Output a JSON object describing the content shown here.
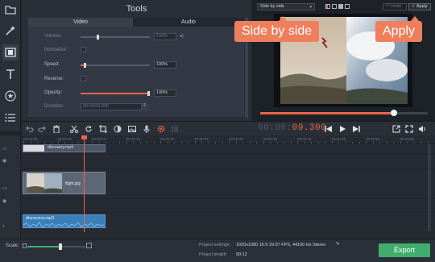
{
  "tools": {
    "title": "Tools",
    "tabs": [
      {
        "label": "Video"
      },
      {
        "label": "Audio"
      }
    ],
    "rows": {
      "volume": {
        "label": "Volume:",
        "value": "100%",
        "enabled": false,
        "level": 0.4
      },
      "normalize": {
        "label": "Normalize:",
        "enabled": false
      },
      "speed": {
        "label": "Speed:",
        "value": "100%",
        "enabled": true,
        "level": 0.05
      },
      "reverse": {
        "label": "Reverse:",
        "enabled": true
      },
      "opacity": {
        "label": "Opacity:",
        "value": "100%",
        "enabled": true,
        "level": 1.0
      },
      "duration": {
        "label": "Duration:",
        "value": "00:00:03.000",
        "enabled": false
      }
    }
  },
  "preview": {
    "preset": "Side by side",
    "undo_label": "Undo",
    "apply_label": "Apply",
    "progress": 0.79
  },
  "callouts": {
    "side_by_side": "Side by side",
    "apply": "Apply"
  },
  "timecode": {
    "dim": "00:00:",
    "active": "09.300"
  },
  "ruler": {
    "labels": [
      "00:00:00",
      "00:00:05",
      "00:00:10",
      "00:00:15",
      "00:00:20",
      "00:00:25",
      "00:00:30",
      "00:00:35",
      "00:00:40",
      "00:00:45",
      "00:00:50",
      "00:00:55"
    ]
  },
  "clips": {
    "top_label": "discovery.mp4",
    "image_label": "flight.jpg",
    "audio_label": "discovery.mp3"
  },
  "bottom": {
    "scale_label": "Scale:",
    "scale_level": 0.55,
    "project_settings_label": "Project settings:",
    "project_settings_value": "1920x1080 16:9 29.97 FPS, 44100 Hz Stereo",
    "project_length_label": "Project length:",
    "project_length_value": "00:12",
    "export_label": "Export"
  },
  "colors": {
    "accent": "#e8654a",
    "callout": "#ef7f5c",
    "export": "#3fae6d",
    "audio_clip": "#3b7fb8"
  }
}
